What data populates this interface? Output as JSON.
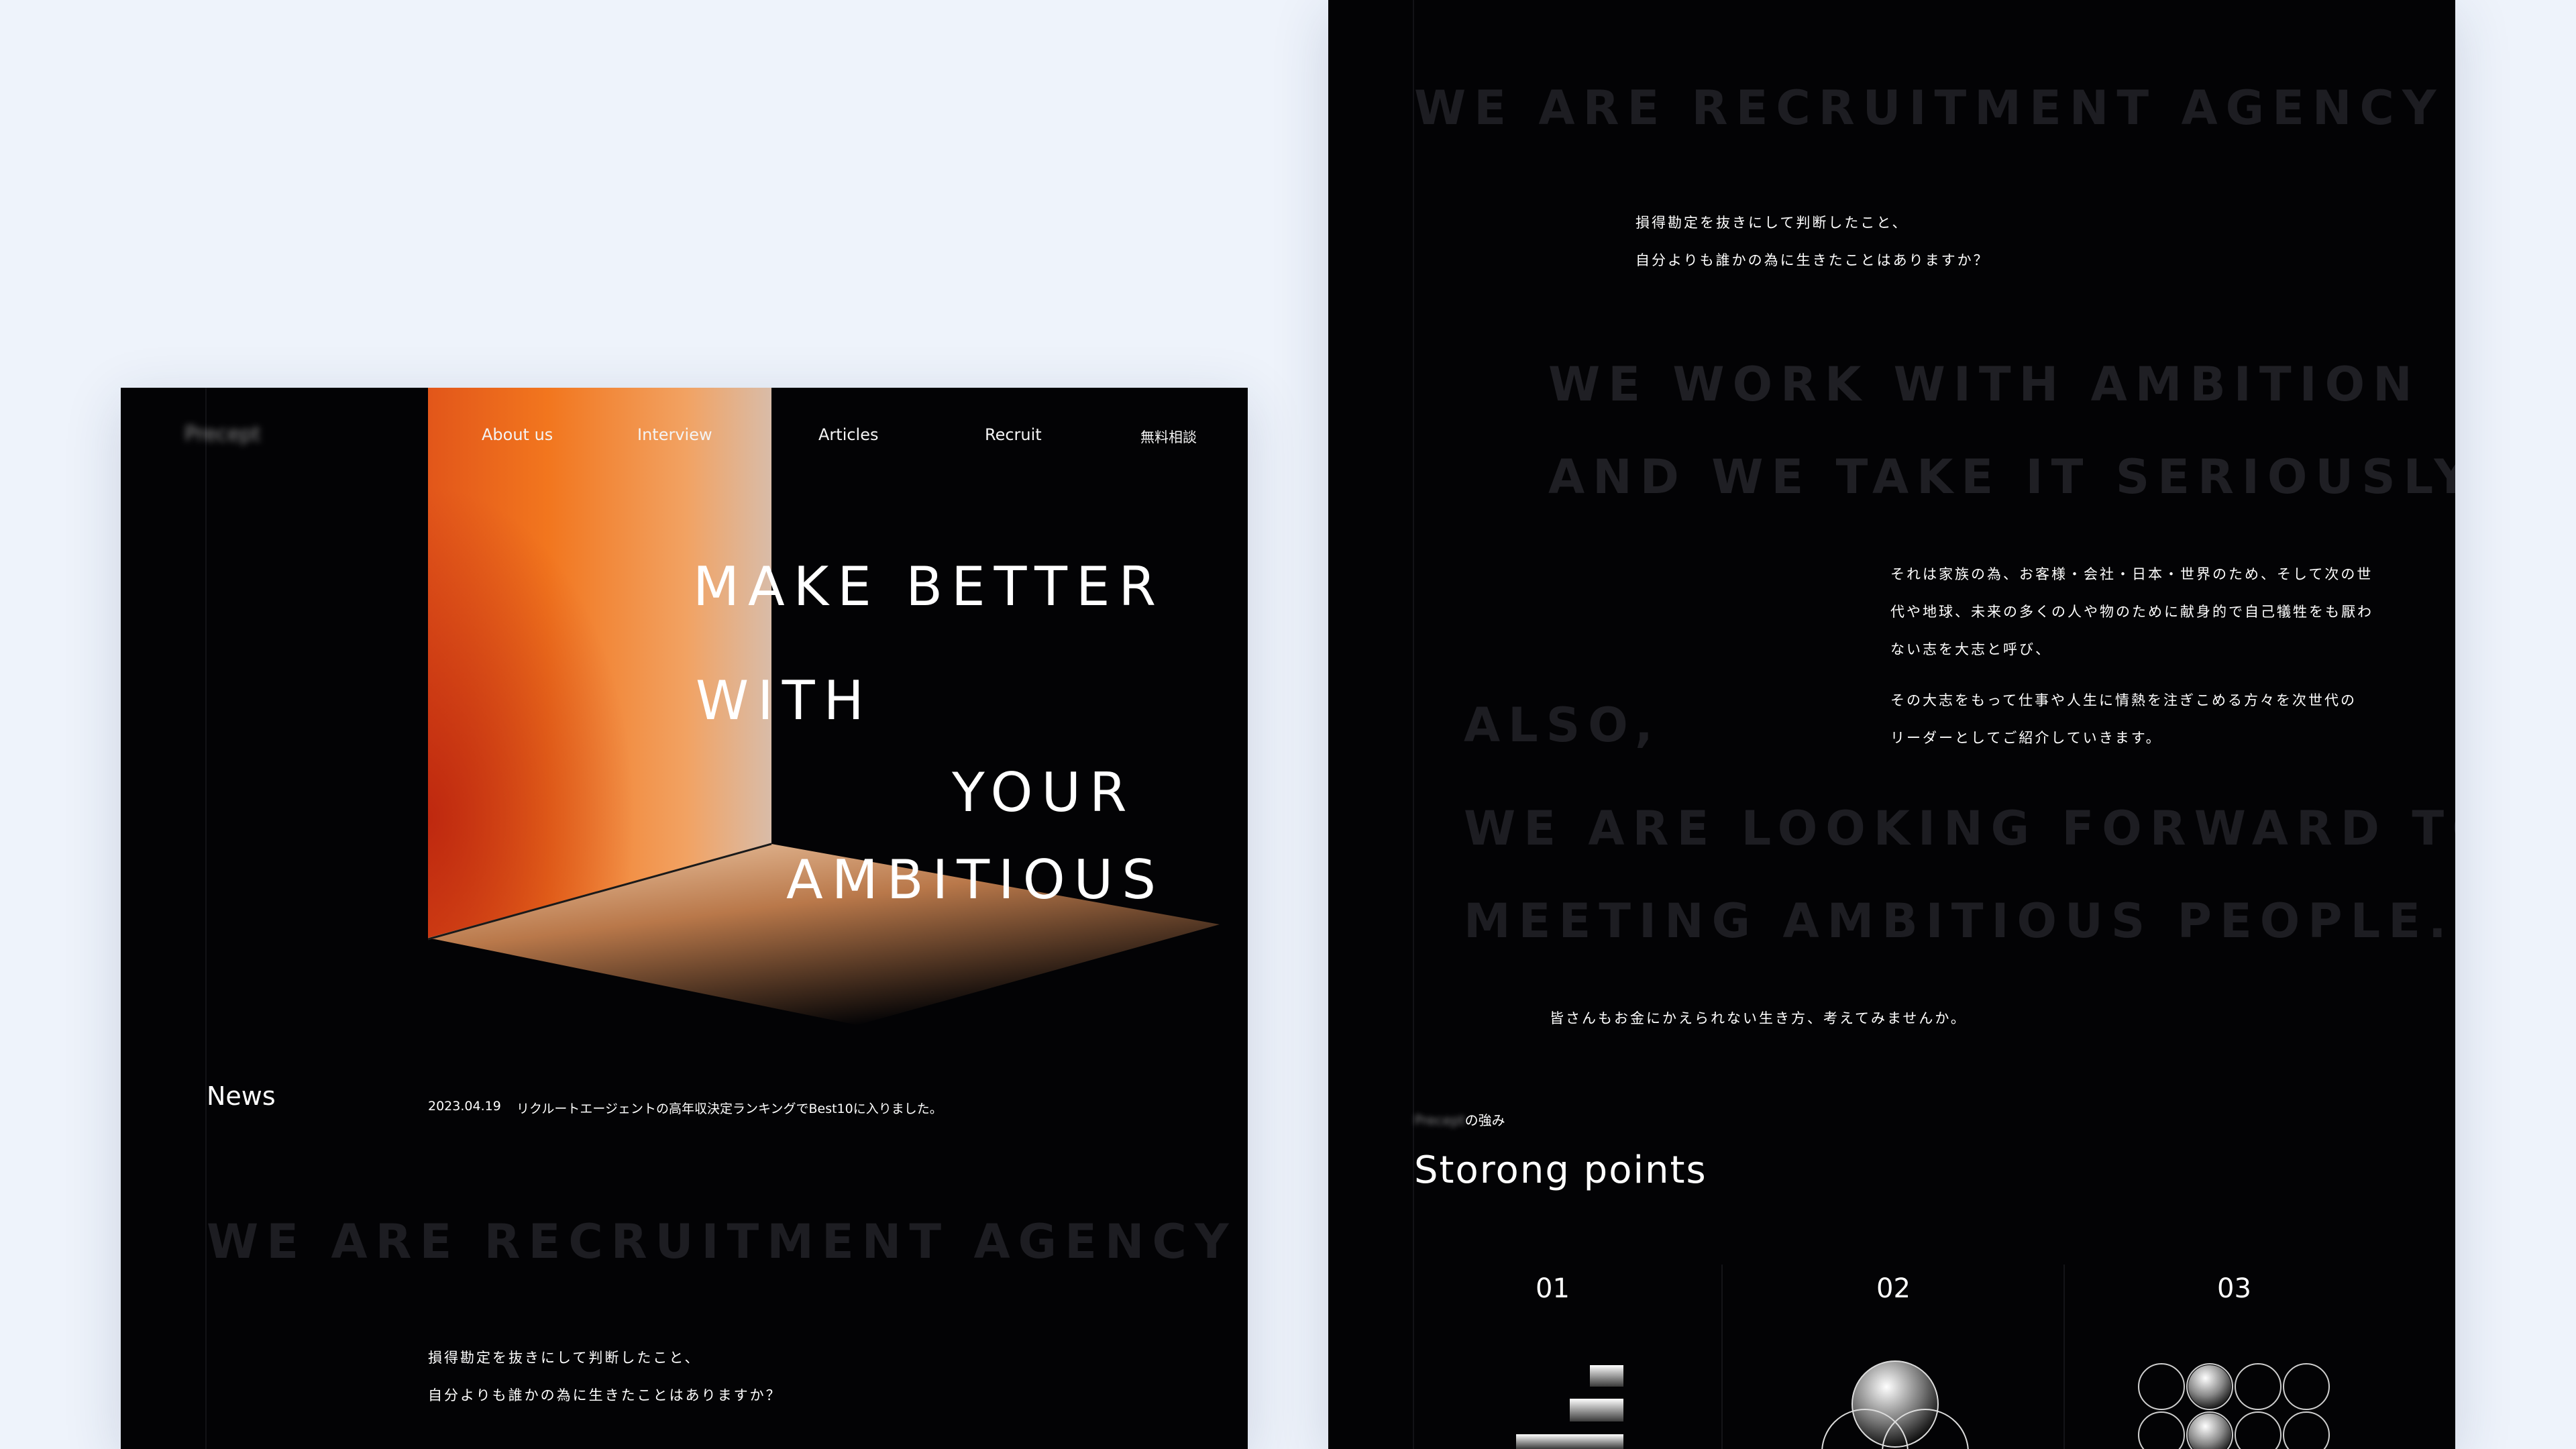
{
  "left": {
    "logo": "Precept",
    "nav": {
      "about": "About us",
      "interview": "Interview",
      "articles": "Articles",
      "recruit": "Recruit",
      "consult": "無料相談"
    },
    "hero": {
      "line1": "MAKE BETTER",
      "line2": "WITH",
      "line3": "YOUR",
      "line4": "AMBITIOUS"
    },
    "news": {
      "heading": "News",
      "date": "2023.04.19",
      "text": "リクルートエージェントの高年収決定ランキングでBest10に入りました。"
    },
    "agency": "WE ARE RECRUITMENT AGENCY",
    "intro_line1": "損得勘定を抜きにして判断したこと、",
    "intro_line2": "自分よりも誰かの為に生きたことはありますか？"
  },
  "right": {
    "agency": "WE ARE RECRUITMENT AGENCY",
    "intro_line1": "損得勘定を抜きにして判断したこと、",
    "intro_line2": "自分よりも誰かの為に生きたことはありますか？",
    "ambition_line1": "WE WORK WITH AMBITION",
    "ambition_line2": "AND WE TAKE IT SERIOUSLY.",
    "para1_line1": "それは家族の為、お客様・会社・日本・世界のため、そして次の世",
    "para1_line2": "代や地球、未来の多くの人や物のために献身的で自己犠牲をも厭わ",
    "para1_line3": "ない志を大志と呼び、",
    "para2_line1": "その大志をもって仕事や人生に情熱を注ぎこめる方々を次世代の",
    "para2_line2": "リーダーとしてご紹介していきます。",
    "also": "ALSO,",
    "forward_line1": "WE ARE LOOKING FORWARD TO",
    "forward_line2": "MEETING AMBITIOUS PEOPLE.",
    "closing": "皆さんもお金にかえられない生き方、考えてみませんか。",
    "strong_brand": "Precept",
    "strong_suffix": "の強み",
    "strong_title": "Storong points",
    "points": [
      "01",
      "02",
      "03"
    ]
  }
}
